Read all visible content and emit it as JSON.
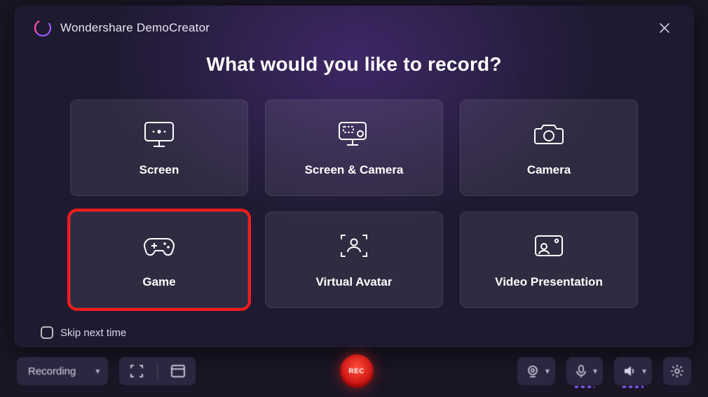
{
  "header": {
    "app_title": "Wondershare DemoCreator"
  },
  "modal": {
    "headline": "What would you like to record?",
    "options": [
      {
        "label": "Screen"
      },
      {
        "label": "Screen & Camera"
      },
      {
        "label": "Camera"
      },
      {
        "label": "Game"
      },
      {
        "label": "Virtual Avatar"
      },
      {
        "label": "Video Presentation"
      }
    ],
    "skip_label": "Skip next time",
    "skip_checked": false,
    "highlighted_option_index": 3
  },
  "bottom_bar": {
    "mode_label": "Recording",
    "rec_label": "REC"
  }
}
